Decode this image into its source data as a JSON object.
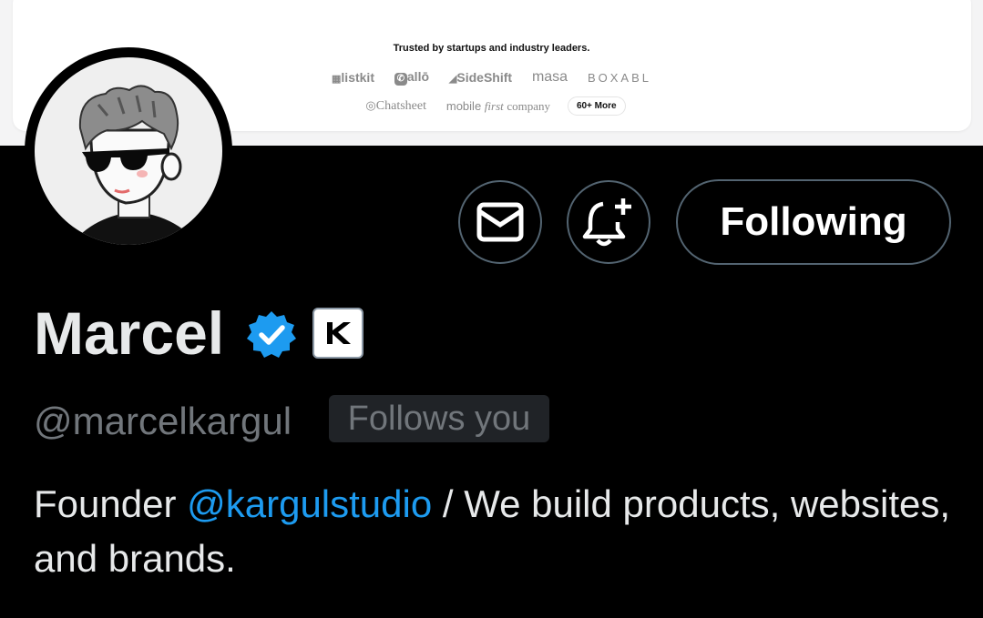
{
  "banner": {
    "trusted_text": "Trusted by startups and industry leaders.",
    "logos_row1": [
      "listkit",
      "allō",
      "SideShift",
      "masa",
      "BOXABL"
    ],
    "logos_row2": [
      "Chatsheet",
      "mobile",
      "first",
      "company"
    ],
    "more_label": "60+ More"
  },
  "actions": {
    "message_icon": "envelope-icon",
    "notify_icon": "bell-plus-icon",
    "following_label": "Following"
  },
  "profile": {
    "name": "Marcel",
    "handle": "@marcelkargul",
    "follows_you": "Follows you",
    "bio_prefix": "Founder ",
    "bio_mention": "@kargulstudio",
    "bio_suffix": " / We build products, websites, and brands."
  },
  "colors": {
    "background": "#000000",
    "verified_blue": "#1d9bf0",
    "text_primary": "#e7e9ea",
    "text_secondary": "#71767b",
    "button_border": "#536471"
  }
}
